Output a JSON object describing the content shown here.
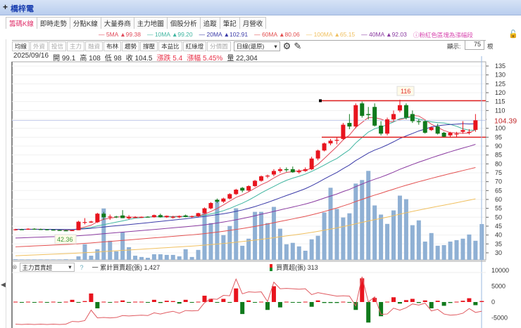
{
  "window": {
    "title": "橋梓電",
    "plus": "+"
  },
  "tabs": [
    "籌碼K線",
    "即時走勢",
    "分點K線",
    "大量券商",
    "主力地圖",
    "個股分析",
    "追蹤",
    "筆記",
    "月營收"
  ],
  "ma_legend": [
    {
      "label": "5MA",
      "value": "▲99.38",
      "color": "#e04a5a"
    },
    {
      "label": "10MA",
      "value": "▲99.20",
      "color": "#3fb5a0"
    },
    {
      "label": "20MA",
      "value": "▲102.91",
      "color": "#3a3aa8"
    },
    {
      "label": "60MA",
      "value": "▲80.06",
      "color": "#e35050"
    },
    {
      "label": "100MA",
      "value": "▲65.15",
      "color": "#f0c060"
    },
    {
      "label": "40MA",
      "value": "▲92.03",
      "color": "#8a3aa0"
    }
  ],
  "ma_note": "ⓘ粉紅色區塊為漲幅段",
  "toolbar": {
    "buttons": [
      {
        "label": "均線",
        "on": true
      },
      {
        "label": "外資",
        "on": false
      },
      {
        "label": "投信",
        "on": false
      },
      {
        "label": "主力",
        "on": false
      },
      {
        "label": "融資",
        "on": false
      },
      {
        "label": "布林",
        "on": true
      },
      {
        "label": "趨勢",
        "on": true
      },
      {
        "label": "撐壓",
        "on": true
      },
      {
        "label": "本益比",
        "on": true
      },
      {
        "label": "紅綠燈",
        "on": true
      },
      {
        "label": "分價圖",
        "on": false
      }
    ],
    "period": "日線(還原)",
    "show_label": "顯示:",
    "show_count": "75",
    "show_unit": "根"
  },
  "info": {
    "date": "2025/09/16",
    "open": "開 99.1",
    "high": "高 108",
    "low": "低 98",
    "close": "收 104.5",
    "change": "漲跌 5.4",
    "pct": "漲幅 5.45%",
    "volume": "量 22,304"
  },
  "chart_data": {
    "type": "candlestick",
    "yaxis_ticks": [
      135,
      130,
      125,
      120,
      115,
      110,
      105,
      100,
      95,
      90,
      85,
      80,
      75,
      70,
      65,
      60,
      55,
      50,
      45,
      40,
      35,
      30
    ],
    "ylim": [
      26,
      138
    ],
    "last_price_label": "104.39",
    "max_label": "116",
    "min_label": "42.36",
    "resistance": 115.5,
    "support": 95,
    "ohlc": [
      [
        43,
        43.5,
        42.5,
        43.2
      ],
      [
        43.2,
        43.5,
        42.8,
        43.1
      ],
      [
        43,
        43.8,
        42.9,
        43.5
      ],
      [
        43.5,
        43.8,
        43,
        43.2
      ],
      [
        43.3,
        43.6,
        43,
        43.2
      ],
      [
        43.2,
        43.4,
        42.6,
        43.1
      ],
      [
        43,
        43.2,
        42.5,
        42.8
      ],
      [
        42.8,
        43,
        42.4,
        42.6
      ],
      [
        42.6,
        42.8,
        42.36,
        42.5
      ],
      [
        42.5,
        42.9,
        42.4,
        42.7
      ],
      [
        42.7,
        48,
        42.7,
        47.5
      ],
      [
        47.2,
        49.5,
        46,
        47.3
      ],
      [
        47,
        48,
        46.8,
        47.6
      ],
      [
        47.2,
        52.5,
        46.8,
        52
      ],
      [
        52,
        53,
        48.5,
        50
      ],
      [
        50,
        51.5,
        48.5,
        50.4
      ],
      [
        50.4,
        50.8,
        49.5,
        50
      ],
      [
        51,
        54,
        49.5,
        49.5
      ],
      [
        49.4,
        51.2,
        48.8,
        50.3
      ],
      [
        50,
        50.6,
        49.6,
        50.1
      ],
      [
        50,
        50.4,
        49.6,
        50.2
      ],
      [
        50.3,
        50.6,
        49.9,
        50
      ],
      [
        50,
        51.5,
        49.8,
        51.2
      ],
      [
        51.2,
        52,
        49.8,
        50
      ],
      [
        50,
        51,
        49.6,
        50.8
      ],
      [
        50,
        50.8,
        49.2,
        50.2
      ],
      [
        50,
        51,
        49.5,
        50.6
      ],
      [
        51,
        51.5,
        50,
        50.2
      ],
      [
        50.3,
        50.9,
        49.8,
        50.6
      ],
      [
        50.5,
        52.5,
        50.2,
        52.3
      ],
      [
        52.3,
        55.5,
        52,
        55
      ],
      [
        55,
        58.5,
        54.5,
        58
      ],
      [
        59.8,
        60.5,
        58,
        58.8
      ],
      [
        58.8,
        61,
        58,
        60.5
      ],
      [
        60.5,
        63.5,
        60,
        63
      ],
      [
        63,
        66,
        62.5,
        65.5
      ],
      [
        66.5,
        67,
        64,
        65
      ],
      [
        65,
        68,
        64.5,
        67.5
      ],
      [
        67.5,
        71,
        67,
        70.5
      ],
      [
        70.5,
        73.5,
        70,
        73
      ],
      [
        73,
        74,
        72,
        73.4
      ],
      [
        74,
        77,
        73,
        76
      ],
      [
        76,
        78,
        75,
        77
      ],
      [
        77,
        78,
        75.5,
        76.5
      ],
      [
        77,
        78.5,
        75,
        75.3
      ],
      [
        75.3,
        77,
        74.5,
        76
      ],
      [
        76,
        78,
        75.5,
        77
      ],
      [
        77,
        84,
        76.5,
        83
      ],
      [
        83,
        88,
        82,
        87.5
      ],
      [
        87.5,
        92,
        87,
        91.5
      ],
      [
        91.5,
        94,
        90.5,
        93
      ],
      [
        93,
        95,
        91,
        93.5
      ],
      [
        94,
        103,
        93.5,
        102
      ],
      [
        103,
        108,
        99.5,
        101
      ],
      [
        101,
        114,
        100,
        113
      ],
      [
        114,
        115,
        106,
        107
      ],
      [
        108,
        112,
        105,
        107.4
      ],
      [
        112,
        114,
        101,
        101.5
      ],
      [
        101.5,
        104,
        96,
        97
      ],
      [
        97,
        106,
        96,
        105
      ],
      [
        105,
        110,
        104,
        108
      ],
      [
        110,
        116,
        109,
        113
      ],
      [
        113,
        114,
        105,
        106
      ],
      [
        108,
        110,
        103,
        104
      ],
      [
        104,
        105,
        102,
        103.5
      ],
      [
        104,
        104.5,
        97,
        97.5
      ],
      [
        99,
        101,
        98.5,
        100.5
      ],
      [
        101,
        102.5,
        96.5,
        97
      ],
      [
        97.5,
        98,
        95,
        95.3
      ],
      [
        96,
        98,
        95,
        97.5
      ],
      [
        96.5,
        98,
        95,
        97
      ],
      [
        98,
        104,
        97,
        99
      ],
      [
        98,
        99.5,
        96.5,
        98
      ],
      [
        99.1,
        108,
        98,
        104.5
      ]
    ],
    "volume": [
      400,
      300,
      300,
      300,
      300,
      300,
      300,
      300,
      400,
      300,
      2200,
      9700,
      2600,
      6600,
      32000,
      11900,
      5300,
      17200,
      7900,
      2600,
      1800,
      1300,
      3500,
      3500,
      3100,
      3100,
      2200,
      6600,
      1800,
      6200,
      31700,
      22900,
      37400,
      15400,
      21100,
      32100,
      8800,
      13200,
      29900,
      29900,
      22900,
      33000,
      19400,
      9700,
      10600,
      8400,
      5700,
      12800,
      15000,
      29500,
      44900,
      31700,
      26400,
      29000,
      47500,
      49700,
      55400,
      33900,
      28200,
      22400,
      30800,
      40000,
      37800,
      21600,
      24600,
      11400,
      16700,
      8800,
      9200,
      11400,
      12300,
      13200,
      15800,
      11900,
      22304
    ],
    "ma_periods": [
      5,
      10,
      20,
      40,
      60,
      100
    ]
  },
  "panel2": {
    "indicator": "主力買賣超",
    "help": "?",
    "cum_label": "一 累計買賣超(張) 1,427",
    "net_label": "買賣超(張) 313",
    "yaxis_ticks": [
      10000,
      5000,
      0,
      -5000
    ],
    "net": [
      100,
      -100,
      100,
      -100,
      100,
      -100,
      100,
      -100,
      100,
      700,
      -100,
      300,
      2700,
      -2000,
      100,
      -100,
      100,
      500,
      -100,
      100,
      100,
      -100,
      700,
      -300,
      400,
      300,
      -500,
      700,
      -100,
      100,
      2000,
      1000,
      -100,
      1000,
      -100,
      4300,
      -3800,
      500,
      -100,
      100,
      -2500,
      5000,
      -1700,
      100,
      -100,
      -100,
      100,
      -1500,
      500,
      -300,
      -300,
      -300,
      100,
      -100,
      -2500,
      7500,
      -6500,
      1300,
      -4500,
      100,
      1500,
      -500,
      600,
      1000,
      -300,
      500,
      -2000,
      400,
      -1200,
      -300,
      100,
      400,
      1200,
      -1000,
      313
    ]
  }
}
